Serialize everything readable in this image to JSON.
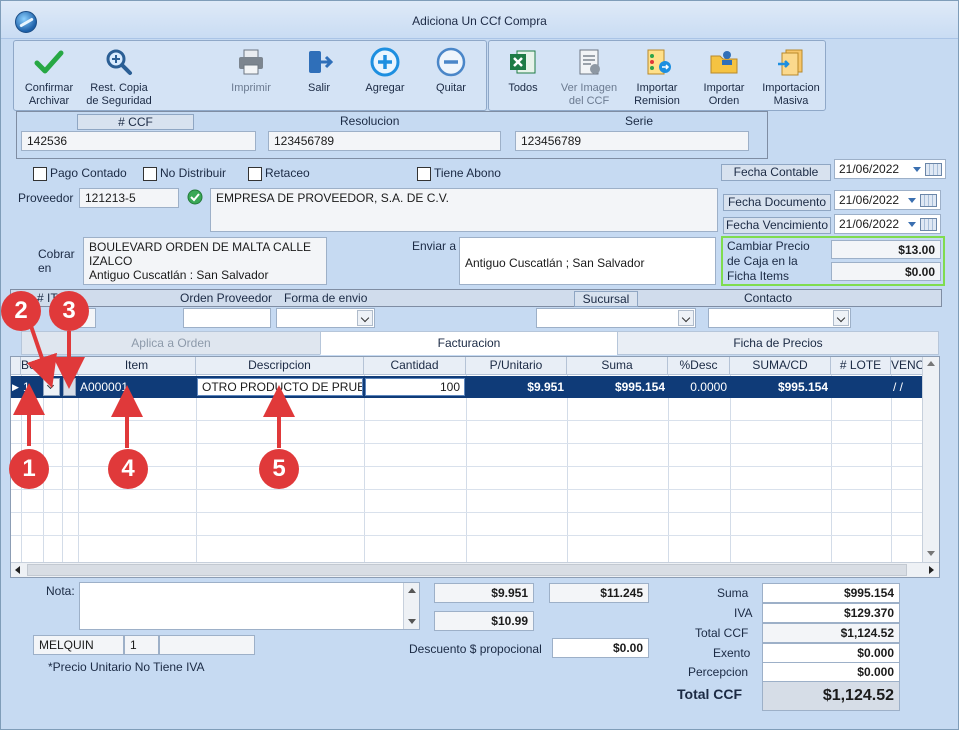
{
  "window": {
    "title": "Adiciona Un CCf Compra"
  },
  "toolbar": {
    "confirm": "Confirmar\nArchivar",
    "restore": "Rest. Copia\nde Seguridad",
    "print": "Imprimir",
    "exit": "Salir",
    "add": "Agregar",
    "remove": "Quitar",
    "all": "Todos",
    "view_image": "Ver Imagen\ndel CCF",
    "import_remission": "Importar\nRemision",
    "import_order": "Importar\nOrden",
    "mass_import": "Importacion\nMasiva"
  },
  "doc": {
    "ccf_label": "# CCF",
    "ccf_value": "142536",
    "resolucion_label": "Resolucion",
    "resolucion_value": "123456789",
    "serie_label": "Serie",
    "serie_value": "123456789"
  },
  "checks": {
    "pago_contado": "Pago Contado",
    "no_distribuir": "No Distribuir",
    "retaceo": "Retaceo",
    "tiene_abono": "Tiene Abono"
  },
  "dates": {
    "fecha_contable_label": "Fecha Contable",
    "fecha_contable": "21/06/2022",
    "fecha_documento_label": "Fecha Documento",
    "fecha_documento": "21/06/2022",
    "fecha_vencimiento_label": "Fecha Vencimiento",
    "fecha_vencimiento": "21/06/2022"
  },
  "proveedor": {
    "label": "Proveedor",
    "code": "121213-5",
    "name": "EMPRESA DE PROVEEDOR, S.A. DE C.V."
  },
  "cobrar": {
    "label": "Cobrar\nen",
    "address": "BOULEVARD ORDEN DE MALTA CALLE\nIZALCO\nAntiguo Cuscatlán : San Salvador"
  },
  "enviar": {
    "label": "Enviar a",
    "address": "Antiguo Cuscatlán ; San Salvador"
  },
  "caja": {
    "label": "Cambiar Precio\nde Caja en la\nFicha Items",
    "value1": "$13.00",
    "value2": "$0.00"
  },
  "order": {
    "num_label": "# IT",
    "orden_proveedor": "Orden Proveedor",
    "forma_envio": "Forma de envio",
    "sucursal": "Sucursal",
    "contacto": "Contacto"
  },
  "tabs": [
    "Aplica a Orden",
    "Facturacion",
    "Ficha de Precios"
  ],
  "grid": {
    "headers": [
      "Boega",
      "",
      "",
      "Item",
      "Descripcion",
      "Cantidad",
      "P/Unitario",
      "Suma",
      "%Desc",
      "SUMA/CD",
      "# LOTE",
      "VENC"
    ],
    "row": {
      "bodega": "1",
      "item": "A000001",
      "descripcion": "OTRO PRODUCTO DE PRUEBA",
      "cantidad": "100",
      "unitario": "$9.951",
      "suma": "$995.154",
      "desc": "0.0000",
      "suma_cd": "$995.154",
      "venc": "/ /"
    }
  },
  "markers": [
    "1",
    "2",
    "3",
    "4",
    "5"
  ],
  "footer": {
    "nota_label": "Nota:",
    "val_a": "$9.951",
    "val_b": "$11.245",
    "val_c": "$10.99",
    "descuento_label": "Descuento $ propocional",
    "descuento": "$0.00",
    "user": "MELQUIN",
    "user_num": "1",
    "note_iva": "*Precio Unitario No Tiene IVA"
  },
  "totals": {
    "suma_label": "Suma",
    "suma": "$995.154",
    "iva_label": "IVA",
    "iva": "$129.370",
    "total_ccf_label": "Total CCF",
    "total_ccf": "$1,124.52",
    "exento_label": "Exento",
    "exento": "$0.000",
    "percepcion_label": "Percepcion",
    "percepcion": "$0.000",
    "grand_label": "Total CCF",
    "grand": "$1,124.52"
  },
  "colors": {
    "accent": "#0f3b78",
    "marker": "#e0393a",
    "highlight_border": "#7fdc4f"
  }
}
